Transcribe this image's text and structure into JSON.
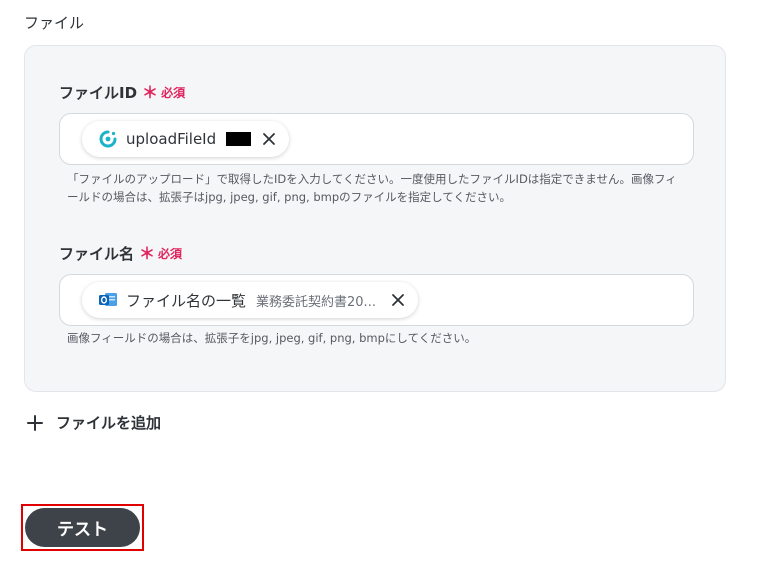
{
  "section": {
    "title": "ファイル"
  },
  "fields": [
    {
      "label": "ファイルID",
      "required_label": "必須",
      "chip": {
        "icon": "yoom-app-icon",
        "text": "uploadFileId",
        "redacted": true
      },
      "help_line1": "「ファイルのアップロード」で取得したIDを入力してください。一度使用したファイルIDは指定できません。画像フィ",
      "help_line2": "ールドの場合は、拡張子はjpg, jpeg, gif, png, bmpのファイルを指定してください。"
    },
    {
      "label": "ファイル名",
      "required_label": "必須",
      "chip": {
        "icon": "outlook-icon",
        "text": "ファイル名の一覧",
        "subtext": "業務委託契約書20..."
      },
      "help_line1": "画像フィールドの場合は、拡張子をjpg, jpeg, gif, png, bmpにしてください。"
    }
  ],
  "add_file": {
    "label": "ファイルを追加",
    "icon": "plus-icon"
  },
  "test_button": {
    "label": "テスト"
  },
  "colors": {
    "required": "#e0245e",
    "button_bg": "#3e4249",
    "highlight": "#e00000",
    "panel_bg": "#f5f6f8"
  }
}
